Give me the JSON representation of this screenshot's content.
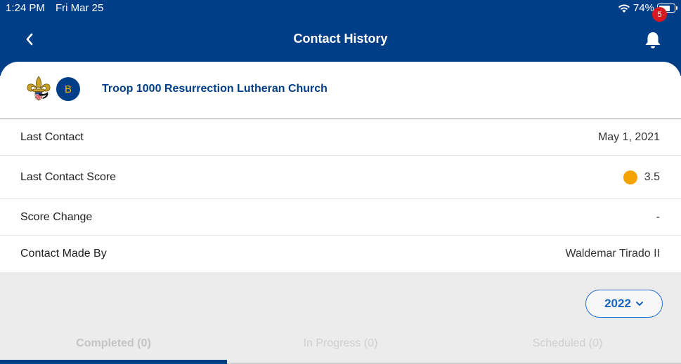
{
  "status_bar": {
    "time": "1:24 PM",
    "date": "Fri Mar 25",
    "battery_text": "74%",
    "battery_level": 0.74
  },
  "nav": {
    "title": "Contact History",
    "back_icon": "chevron-left-icon",
    "notification_icon": "bell-icon",
    "notification_count": "5"
  },
  "unit": {
    "avatar_initial": "B",
    "name": "Troop 1000 Resurrection Lutheran Church"
  },
  "details": [
    {
      "label": "Last Contact",
      "value": "May 1, 2021"
    },
    {
      "label": "Last Contact Score",
      "value": "3.5",
      "indicator_color": "#f5a300"
    },
    {
      "label": "Score Change",
      "value": "-"
    },
    {
      "label": "Contact Made By",
      "value": "Waldemar Tirado II"
    }
  ],
  "year_selector": {
    "value": "2022",
    "icon": "chevron-down-icon"
  },
  "tabs": [
    {
      "label": "Completed (0)",
      "active": true
    },
    {
      "label": "In Progress (0)",
      "active": false
    },
    {
      "label": "Scheduled (0)",
      "active": false
    }
  ],
  "colors": {
    "header": "#003f87",
    "accent": "#1565c0",
    "badge": "#d71921",
    "brand_gold": "#f3b500"
  }
}
